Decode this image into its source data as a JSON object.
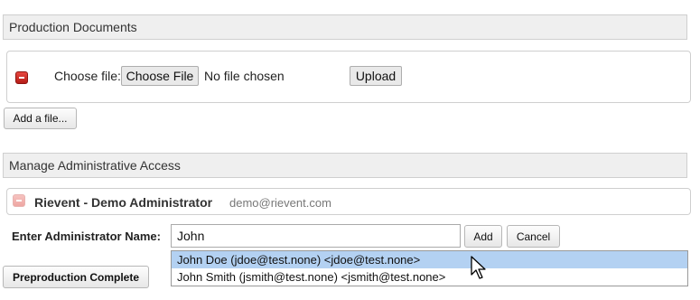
{
  "production_documents": {
    "title": "Production Documents",
    "choose_file_label": "Choose file:",
    "choose_file_button": "Choose File",
    "no_file_text": "No file chosen",
    "upload_button": "Upload",
    "add_file_button": "Add a file..."
  },
  "admin_access": {
    "title": "Manage Administrative Access",
    "existing_admin": {
      "name": "Rievent - Demo Administrator",
      "email": "demo@rievent.com"
    },
    "enter_name_label": "Enter Administrator Name:",
    "name_input_value": "John",
    "add_button": "Add",
    "cancel_button": "Cancel",
    "suggestions": [
      {
        "label": "John Doe (jdoe@test.none) <jdoe@test.none>",
        "selected": true
      },
      {
        "label": "John Smith (jsmith@test.none) <jsmith@test.none>",
        "selected": false
      }
    ]
  },
  "preproduction_button": "Preproduction Complete"
}
